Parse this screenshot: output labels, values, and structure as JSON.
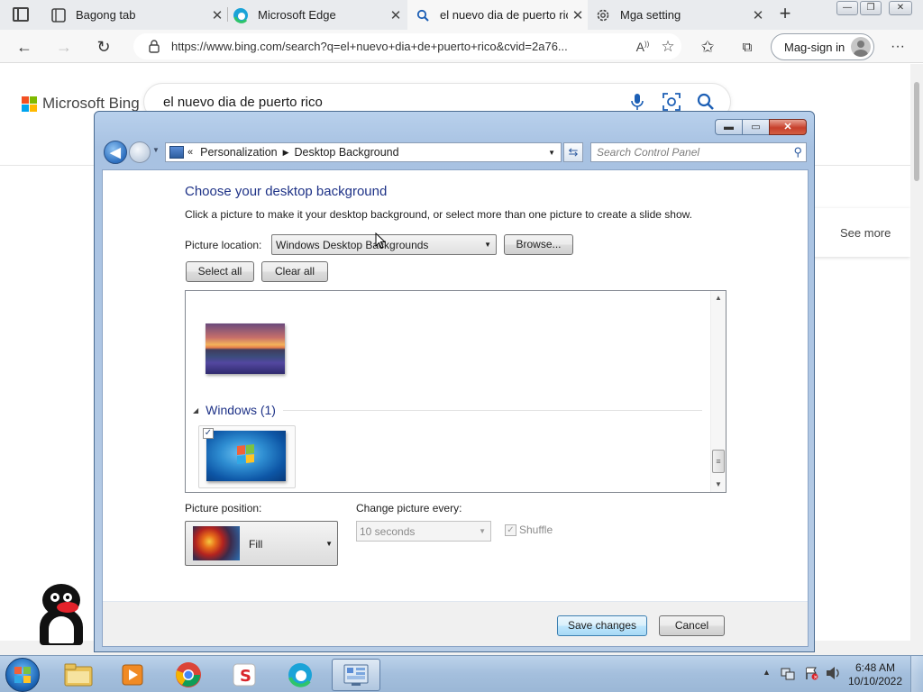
{
  "browser": {
    "tabs": [
      {
        "title": "Bagong tab",
        "icon": "tab-page-icon",
        "active": false
      },
      {
        "title": "Microsoft Edge",
        "icon": "edge-icon",
        "active": false
      },
      {
        "title": "el nuevo dia de puerto rico",
        "icon": "search-icon",
        "active": true
      },
      {
        "title": "Mga setting",
        "icon": "gear-icon",
        "active": false
      }
    ],
    "new_tab_label": "+",
    "url": "https://www.bing.com/search?q=el+nuevo+dia+de+puerto+rico&cvid=2a76...",
    "signin_label": "Mag-sign in"
  },
  "bing": {
    "logo_text": "Microsoft Bing",
    "query": "el nuevo dia de puerto rico",
    "see_more": "See more"
  },
  "control_panel": {
    "breadcrumb": [
      "Personalization",
      "Desktop Background"
    ],
    "search_placeholder": "Search Control Panel",
    "title": "Choose your desktop background",
    "description": "Click a picture to make it your desktop background, or select more than one picture to create a slide show.",
    "picture_location_label": "Picture location:",
    "picture_location_value": "Windows Desktop Backgrounds",
    "browse_label": "Browse...",
    "select_all_label": "Select all",
    "clear_all_label": "Clear all",
    "group_name": "Windows (1)",
    "picture_position_label": "Picture position:",
    "picture_position_value": "Fill",
    "change_every_label": "Change picture every:",
    "change_every_value": "10 seconds",
    "shuffle_label": "Shuffle",
    "save_label": "Save changes",
    "cancel_label": "Cancel"
  },
  "taskbar": {
    "time": "6:48 AM",
    "date": "10/10/2022"
  },
  "colors": {
    "accent_blue": "#1e3287",
    "taskbar": "#a4bfdd",
    "edge_tabbar": "#e9ebee"
  }
}
